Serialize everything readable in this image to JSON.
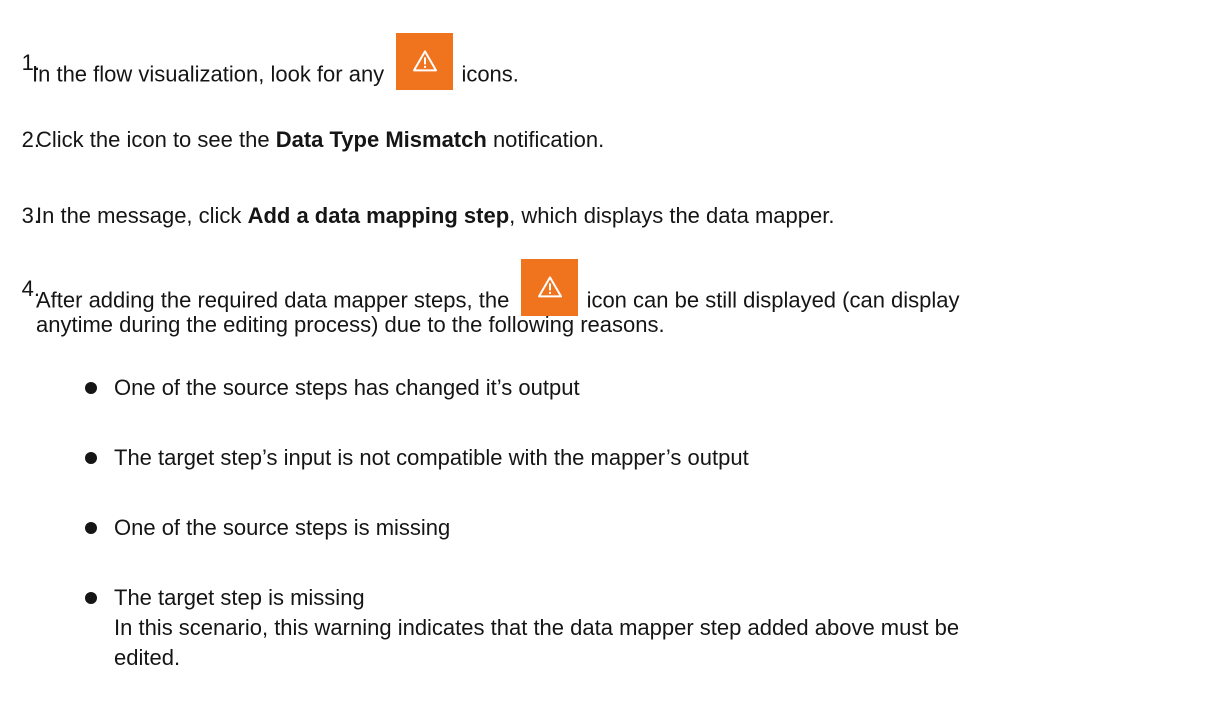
{
  "steps": [
    {
      "number": "1.",
      "before": "In the flow visualization, look for any",
      "after": "icons."
    },
    {
      "number": "2.",
      "before": "Click the icon to see the",
      "strong": "Data Type Mismatch",
      "after": "notification."
    },
    {
      "number": "3.",
      "before": "In the message, click",
      "strong": "Add a data mapping step",
      "after": ", which displays the data mapper."
    },
    {
      "number": "4.",
      "before": "After adding the required data mapper steps, the",
      "after": "icon can be still displayed (can display",
      "line2": "anytime during the editing process) due to the following reasons."
    }
  ],
  "reasons": [
    {
      "text": "One of the source steps has changed it’s output"
    },
    {
      "text": "The target step’s input is not compatible with the mapper’s output"
    },
    {
      "text": "One of the source steps is missing"
    },
    {
      "text": "The target step is missing",
      "note_line1": "In this scenario, this warning indicates that the data mapper step added above must be",
      "note_line2": "edited."
    }
  ],
  "icons": {
    "warning_icon": "warning-triangle-icon",
    "warning_color": "#f0731e"
  }
}
